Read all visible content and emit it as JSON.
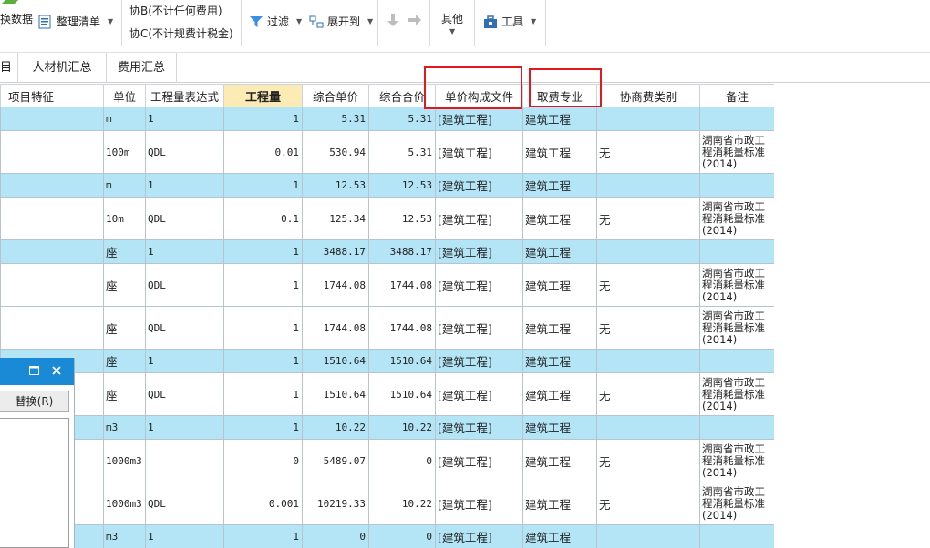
{
  "ribbon": {
    "convert_data": "换数据",
    "organize_list": "整理清单",
    "xie_b": "协B(不计任何费用)",
    "xie_c": "协C(不计规费计税金)",
    "filter": "过滤",
    "expand_to": "展开到",
    "other": "其他",
    "tools": "工具"
  },
  "tabs": [
    "目",
    "人材机汇总",
    "费用汇总"
  ],
  "columns": [
    "项目特征",
    "单位",
    "工程量表达式",
    "工程量",
    "综合单价",
    "综合合价",
    "单价构成文件",
    "取费专业",
    "协商费类别",
    "备注"
  ],
  "rows": [
    {
      "type": "parent",
      "unit": "m",
      "expr": "1",
      "qty": "1",
      "price": "5.31",
      "total": "5.31",
      "file": "[建筑工程]",
      "major": "建筑工程",
      "cat": "",
      "note": ""
    },
    {
      "type": "child",
      "unit": "100m",
      "expr": "QDL",
      "qty": "0.01",
      "price": "530.94",
      "total": "5.31",
      "file": "[建筑工程]",
      "major": "建筑工程",
      "cat": "无",
      "note": "湖南省市政工程消耗量标准(2014)"
    },
    {
      "type": "parent",
      "unit": "m",
      "expr": "1",
      "qty": "1",
      "price": "12.53",
      "total": "12.53",
      "file": "[建筑工程]",
      "major": "建筑工程",
      "cat": "",
      "note": ""
    },
    {
      "type": "child",
      "unit": "10m",
      "expr": "QDL",
      "qty": "0.1",
      "price": "125.34",
      "total": "12.53",
      "file": "[建筑工程]",
      "major": "建筑工程",
      "cat": "无",
      "note": "湖南省市政工程消耗量标准(2014)"
    },
    {
      "type": "parent",
      "unit": "座",
      "expr": "1",
      "qty": "1",
      "price": "3488.17",
      "total": "3488.17",
      "file": "[建筑工程]",
      "major": "建筑工程",
      "cat": "",
      "note": ""
    },
    {
      "type": "child",
      "unit": "座",
      "expr": "QDL",
      "qty": "1",
      "price": "1744.08",
      "total": "1744.08",
      "file": "[建筑工程]",
      "major": "建筑工程",
      "cat": "无",
      "note": "湖南省市政工程消耗量标准(2014)"
    },
    {
      "type": "child",
      "unit": "座",
      "expr": "QDL",
      "qty": "1",
      "price": "1744.08",
      "total": "1744.08",
      "file": "[建筑工程]",
      "major": "建筑工程",
      "cat": "无",
      "note": "湖南省市政工程消耗量标准(2014)"
    },
    {
      "type": "parent",
      "unit": "座",
      "expr": "1",
      "qty": "1",
      "price": "1510.64",
      "total": "1510.64",
      "file": "[建筑工程]",
      "major": "建筑工程",
      "cat": "",
      "note": ""
    },
    {
      "type": "child",
      "unit": "座",
      "expr": "QDL",
      "qty": "1",
      "price": "1510.64",
      "total": "1510.64",
      "file": "[建筑工程]",
      "major": "建筑工程",
      "cat": "无",
      "note": "湖南省市政工程消耗量标准(2014)"
    },
    {
      "type": "parent",
      "unit": "m3",
      "expr": "1",
      "qty": "1",
      "price": "10.22",
      "total": "10.22",
      "file": "[建筑工程]",
      "major": "建筑工程",
      "cat": "",
      "note": ""
    },
    {
      "type": "child",
      "unit": "1000m3",
      "expr": "",
      "qty": "0",
      "price": "5489.07",
      "total": "0",
      "file": "[建筑工程]",
      "major": "建筑工程",
      "cat": "无",
      "note": "湖南省市政工程消耗量标准(2014)"
    },
    {
      "type": "child",
      "unit": "1000m3",
      "expr": "QDL",
      "qty": "0.001",
      "price": "10219.33",
      "total": "10.22",
      "file": "[建筑工程]",
      "major": "建筑工程",
      "cat": "无",
      "note": "湖南省市政工程消耗量标准(2014)"
    },
    {
      "type": "parent",
      "unit": "m3",
      "expr": "1",
      "qty": "1",
      "price": "0",
      "total": "0",
      "file": "[建筑工程]",
      "major": "建筑工程",
      "cat": "",
      "note": ""
    }
  ],
  "panel": {
    "replace_button": "替换(R)"
  },
  "colors": {
    "parent_row": "#b3e5f6",
    "header_highlight": "#fdebb6",
    "annotation_red": "#e0191f",
    "panel_title": "#1b8ad6"
  }
}
